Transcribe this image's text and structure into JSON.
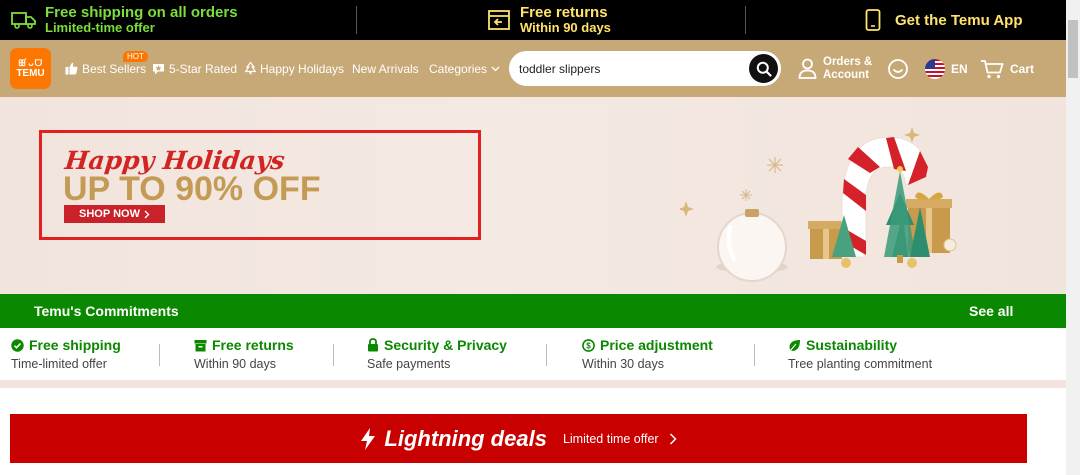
{
  "topbar": {
    "shipping_main": "Free shipping on all orders",
    "shipping_sub": "Limited-time offer",
    "returns_main": "Free returns",
    "returns_sub": "Within 90 days",
    "app_label": "Get the Temu App"
  },
  "header": {
    "logo_top": "ꕥᜒᴗᗜ",
    "logo_brand": "TEMU",
    "nav": {
      "best_sellers": "Best Sellers",
      "hot_badge": "HOT",
      "five_star": "5-Star Rated",
      "happy_holidays": "Happy Holidays",
      "new_arrivals": "New Arrivals",
      "categories": "Categories"
    },
    "search_value": "toddler slippers",
    "orders_line1": "Orders &",
    "orders_line2": "Account",
    "language": "EN",
    "cart": "Cart"
  },
  "banner": {
    "headline": "Happy Holidays",
    "offer": "UP TO 90% OFF",
    "cta": "SHOP NOW"
  },
  "commitments": {
    "title": "Temu's Commitments",
    "see_all": "See all",
    "items": [
      {
        "title": "Free shipping",
        "sub": "Time-limited offer"
      },
      {
        "title": "Free returns",
        "sub": "Within 90 days"
      },
      {
        "title": "Security & Privacy",
        "sub": "Safe payments"
      },
      {
        "title": "Price adjustment",
        "sub": "Within 30 days"
      },
      {
        "title": "Sustainability",
        "sub": "Tree planting commitment"
      }
    ]
  },
  "lightning": {
    "title": "Lightning deals",
    "sub": "Limited time offer"
  },
  "colors": {
    "header_bg": "#c7a877",
    "commit_green": "#0a8800",
    "lightning_red": "#c90000",
    "brand_orange": "#fb7701"
  }
}
